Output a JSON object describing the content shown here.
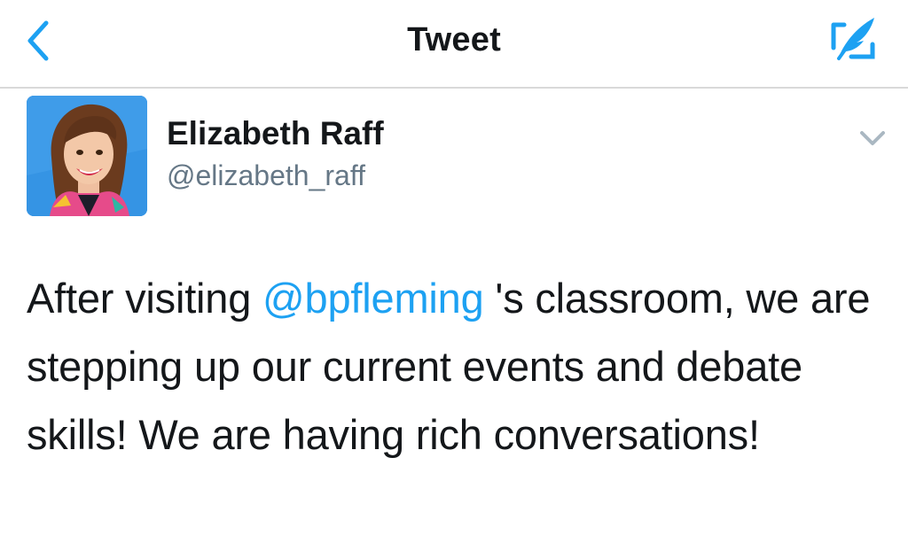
{
  "nav": {
    "title": "Tweet",
    "back_icon": "chevron-left-icon",
    "compose_icon": "compose-tweet-icon"
  },
  "tweet": {
    "author": {
      "name": "Elizabeth Raff",
      "handle": "@elizabeth_raff"
    },
    "menu_icon": "chevron-down-icon",
    "text_before_mention": "After visiting ",
    "mention": "@bpfleming",
    "text_after_mention": " 's classroom, we are stepping up our current events and debate skills! We are having rich conversations!"
  },
  "colors": {
    "accent": "#1da1f2",
    "text": "#14171a",
    "secondary_text": "#657786",
    "divider": "#d9d9d9"
  }
}
